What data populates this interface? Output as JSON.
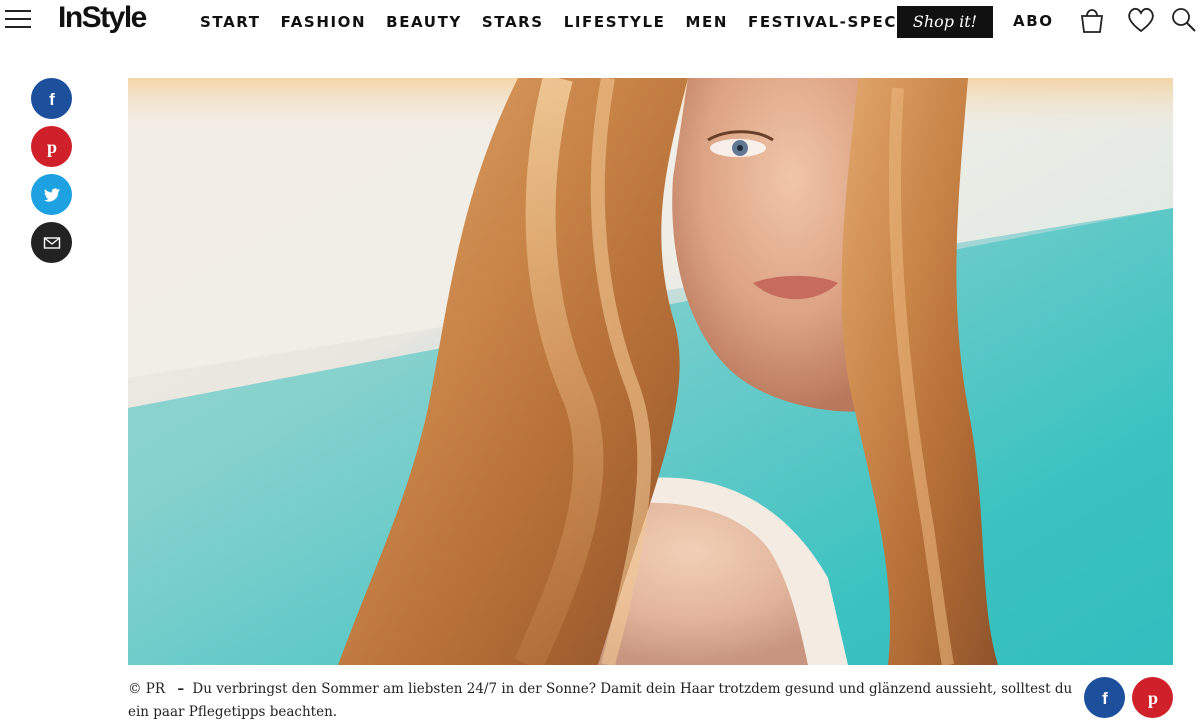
{
  "header": {
    "logo": "InStyle",
    "nav": [
      {
        "label": "START"
      },
      {
        "label": "FASHION"
      },
      {
        "label": "BEAUTY"
      },
      {
        "label": "STARS"
      },
      {
        "label": "LIFESTYLE"
      },
      {
        "label": "MEN"
      },
      {
        "label": "FESTIVAL-SPECIAL"
      }
    ],
    "shop_label": "Shop it!",
    "abo_label": "ABO",
    "icons": [
      "menu-icon",
      "shopping-bag-icon",
      "heart-icon",
      "search-icon"
    ]
  },
  "social_sidebar": {
    "icons": [
      "facebook-icon",
      "pinterest-icon",
      "twitter-icon",
      "mail-icon"
    ],
    "colors": {
      "facebook": "#1c4f9c",
      "pinterest": "#d0202a",
      "twitter": "#1da1e0",
      "mail": "#222222"
    }
  },
  "caption": {
    "credit": "© PR",
    "dash": "–",
    "text": "Du verbringst den Sommer am liebsten 24/7 in der Sonne? Damit dein Haar trotzdem gesund und glänzend aussieht, solltest du ein paar Pflegetipps beachten."
  },
  "caption_share": {
    "icons": [
      "facebook-icon",
      "pinterest-icon"
    ]
  }
}
